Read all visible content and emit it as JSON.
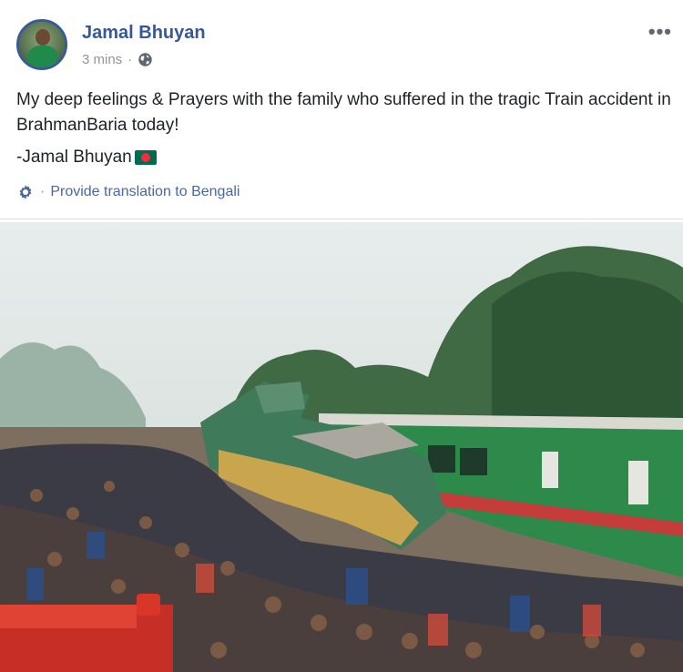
{
  "post": {
    "author": "Jamal Bhuyan",
    "time": "3 mins",
    "meta_separator": "·",
    "more_label": "•••",
    "message": "My deep feelings & Prayers with the family who suffered in the tragic Train accident in BrahmanBaria today!",
    "signature": "-Jamal Bhuyan",
    "translate_separator": "·",
    "translate_link": "Provide translation to Bengali"
  },
  "icons": {
    "privacy": "globe-icon",
    "translate": "gear-icon",
    "flag": "bangladesh-flag-icon"
  },
  "colors": {
    "link": "#365899",
    "translate_link": "#4b67a1",
    "meta": "#90949c",
    "text": "#1d2129",
    "avatar_border": "#3b5998"
  }
}
